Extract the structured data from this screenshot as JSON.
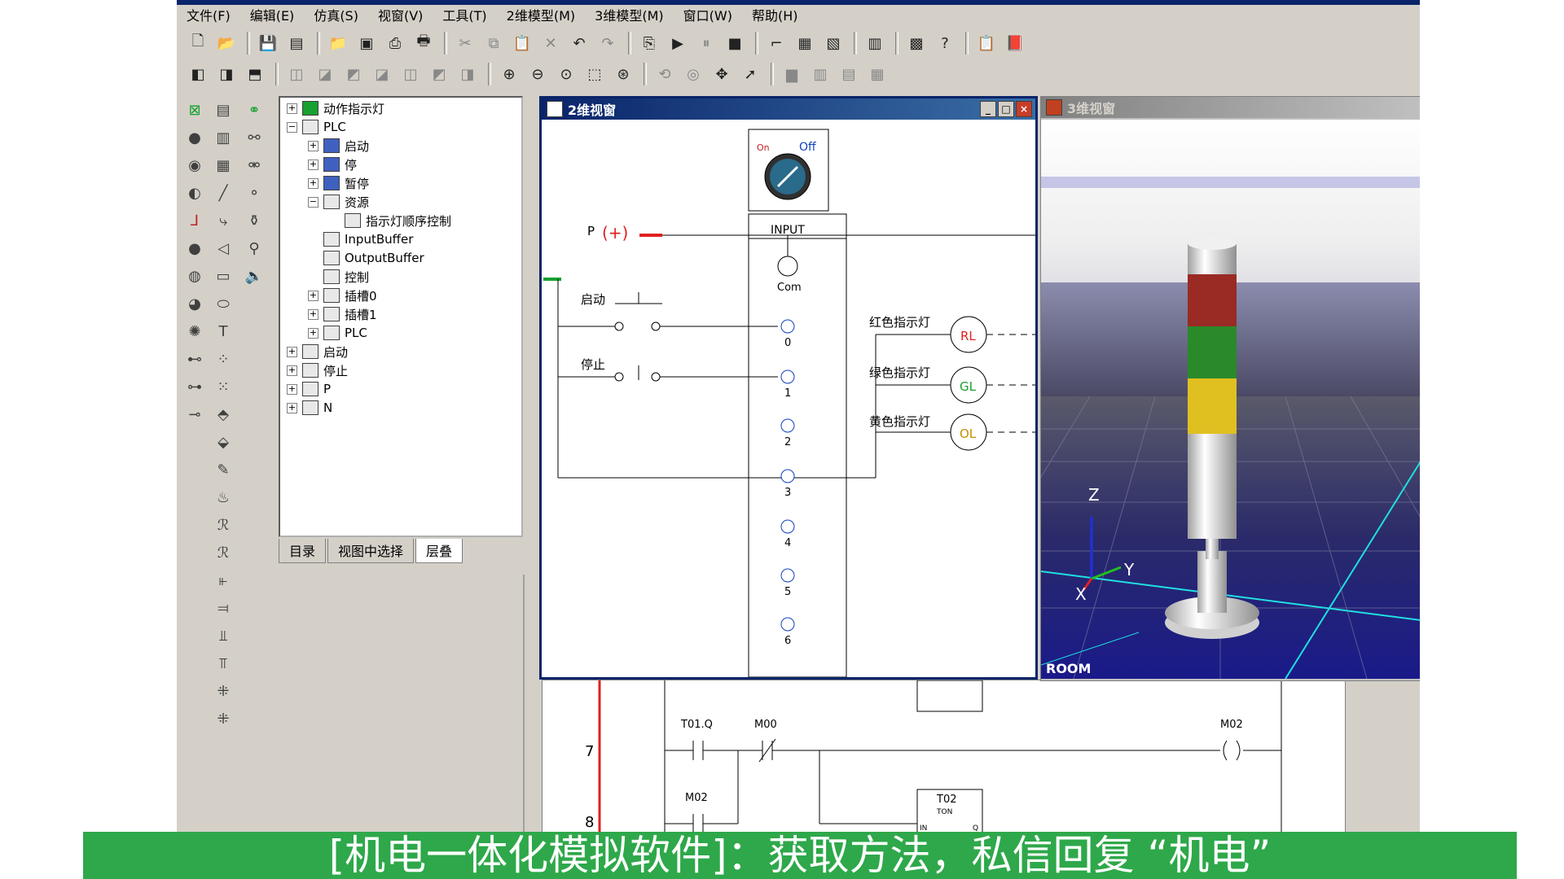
{
  "menu": [
    "文件(F)",
    "编辑(E)",
    "仿真(S)",
    "视窗(V)",
    "工具(T)",
    "2维模型(M)",
    "3维模型(M)",
    "窗口(W)",
    "帮助(H)"
  ],
  "tree": {
    "root": "动作指示灯",
    "plc": "PLC",
    "start": "启动",
    "stop": "停",
    "pause": "暂停",
    "resource": "资源",
    "seq": "指示灯顺序控制",
    "inbuf": "InputBuffer",
    "outbuf": "OutputBuffer",
    "control": "控制",
    "slot0": "插槽0",
    "slot1": "插槽1",
    "plc2": "PLC",
    "start2": "启动",
    "stop2": "停止",
    "p": "P",
    "n": "N"
  },
  "tabs": [
    "目录",
    "视图中选择",
    "层叠"
  ],
  "win2d": {
    "title": "2维视窗",
    "switch_on": "On",
    "switch_off": "Off",
    "p_label": "P",
    "plus": "(+)",
    "input_label": "INPUT",
    "com_label": "Com",
    "start_label": "启动",
    "stop_label": "停止",
    "terminals": [
      "0",
      "1",
      "2",
      "3",
      "4",
      "5",
      "6"
    ],
    "red_lamp": "红色指示灯",
    "green_lamp": "绿色指示灯",
    "yellow_lamp": "黄色指示灯",
    "rl": "RL",
    "gl": "GL",
    "ol": "OL"
  },
  "win3d": {
    "title": "3维视窗",
    "room": "ROOM",
    "axis_z": "Z",
    "axis_x": "X",
    "axis_y": "Y"
  },
  "ladder": {
    "row7": "7",
    "row8": "8",
    "t01q": "T01.Q",
    "m00": "M00",
    "m02_coil": "M02",
    "m02": "M02",
    "t02": "T02",
    "ton": "TON",
    "in": "IN",
    "q": "Q"
  },
  "banner": "[机电一体化模拟软件]：获取方法，私信回复 “机电”"
}
